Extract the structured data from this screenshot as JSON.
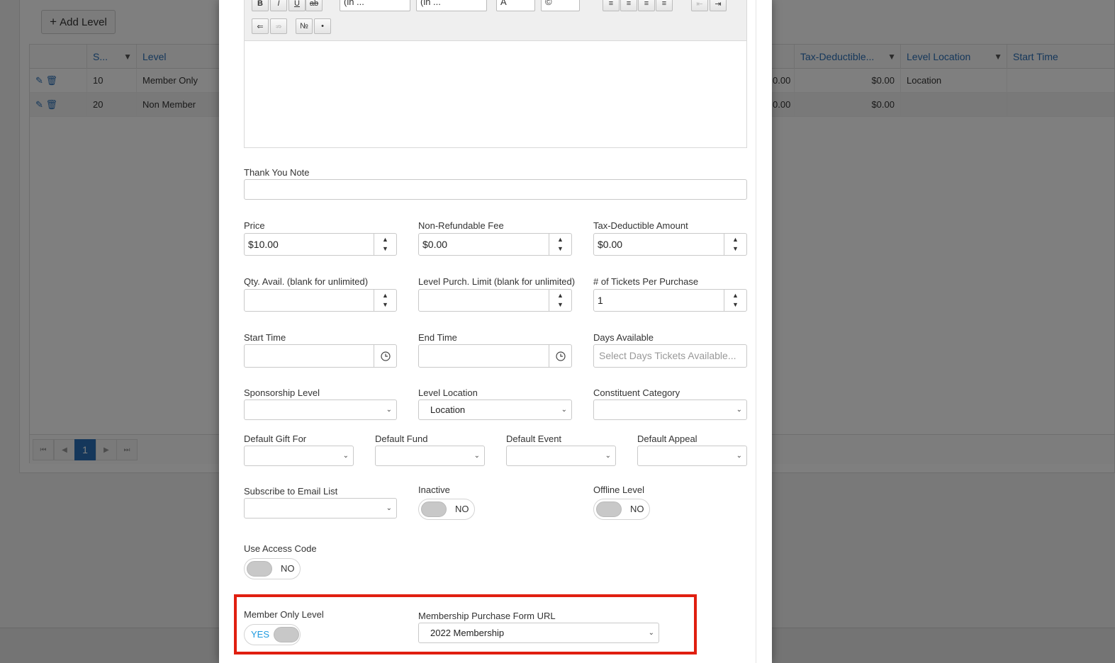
{
  "background": {
    "add_level_label": "Add Level",
    "columns": [
      "S...",
      "Level",
      "Tax-Deductible...",
      "Level Location",
      "Start Time"
    ],
    "rows": [
      {
        "seq": "10",
        "level": "Member Only Level",
        "amount_a": "0.00",
        "tax_deductible": "$0.00",
        "location": "Location"
      },
      {
        "seq": "20",
        "level": "Non Member",
        "amount_a": "0.00",
        "tax_deductible": "$0.00",
        "location": ""
      }
    ],
    "pager": {
      "current_page": "1"
    }
  },
  "editor_toolbar": {
    "bold": "B",
    "italic": "I",
    "underline": "U",
    "strike": "ab",
    "font_select": "(in ...",
    "size_select": "(in ...",
    "color_a": "A",
    "color_b": "©"
  },
  "form": {
    "thank_you_note": {
      "label": "Thank You Note",
      "value": ""
    },
    "price": {
      "label": "Price",
      "value": "$10.00"
    },
    "non_refundable_fee": {
      "label": "Non-Refundable Fee",
      "value": "$0.00"
    },
    "tax_deductible_amount": {
      "label": "Tax-Deductible Amount",
      "value": "$0.00"
    },
    "qty_avail": {
      "label": "Qty. Avail. (blank for unlimited)",
      "value": ""
    },
    "level_purch_limit": {
      "label": "Level Purch. Limit (blank for unlimited)",
      "value": ""
    },
    "tickets_per_purchase": {
      "label": "# of Tickets Per Purchase",
      "value": "1"
    },
    "start_time": {
      "label": "Start Time",
      "value": ""
    },
    "end_time": {
      "label": "End Time",
      "value": ""
    },
    "days_available": {
      "label": "Days Available",
      "placeholder": "Select Days Tickets Available..."
    },
    "sponsorship_level": {
      "label": "Sponsorship Level",
      "value": ""
    },
    "level_location": {
      "label": "Level Location",
      "value": "Location"
    },
    "constituent_category": {
      "label": "Constituent Category",
      "value": ""
    },
    "default_gift_for": {
      "label": "Default Gift For",
      "value": ""
    },
    "default_fund": {
      "label": "Default Fund",
      "value": ""
    },
    "default_event": {
      "label": "Default Event",
      "value": ""
    },
    "default_appeal": {
      "label": "Default Appeal",
      "value": ""
    },
    "subscribe_email_list": {
      "label": "Subscribe to Email List",
      "value": ""
    },
    "inactive": {
      "label": "Inactive",
      "state": "NO"
    },
    "offline_level": {
      "label": "Offline Level",
      "state": "NO"
    },
    "use_access_code": {
      "label": "Use Access Code",
      "state": "NO"
    },
    "member_only_level": {
      "label": "Member Only Level",
      "state": "YES"
    },
    "membership_form_url": {
      "label": "Membership Purchase Form URL",
      "value": "2022 Membership"
    }
  },
  "colors": {
    "accent": "#1e9ae0",
    "link": "#2a6fb6",
    "highlight": "#e01f10"
  }
}
